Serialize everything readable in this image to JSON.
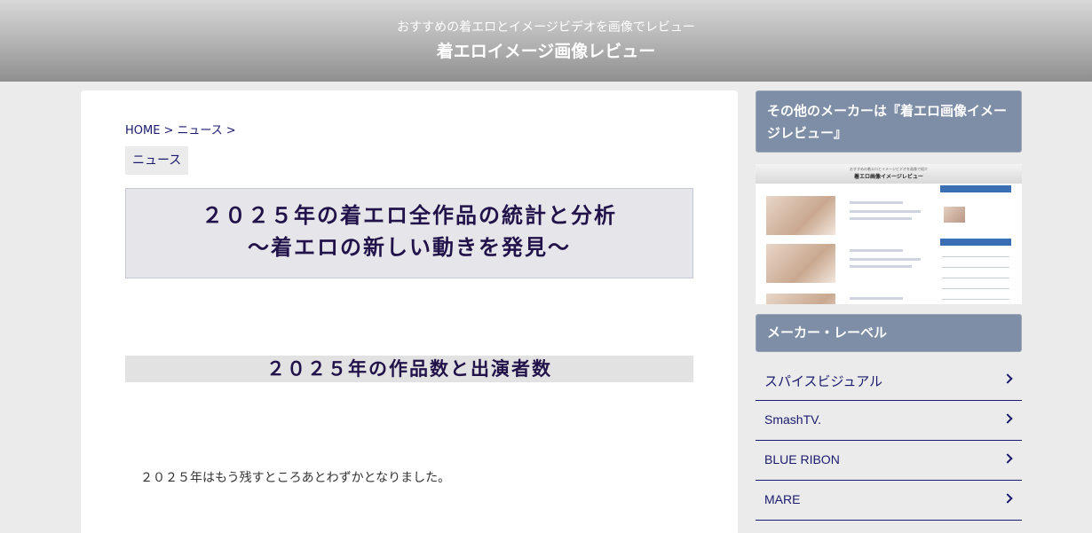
{
  "header": {
    "tagline": "おすすめの着エロとイメージビデオを画像でレビュー",
    "title": "着エロイメージ画像レビュー"
  },
  "breadcrumb": {
    "items": [
      "HOME",
      "ニュース"
    ],
    "separator": ">"
  },
  "category_tag": "ニュース",
  "article": {
    "title_line1": "２０２５年の着エロ全作品の統計と分析",
    "title_line2": "〜着エロの新しい動きを発見〜",
    "section_heading": "２０２５年の作品数と出演者数",
    "body": "２０２５年はもう残すところあとわずかとなりました。"
  },
  "sidebar": {
    "other_makers_heading": "その他のメーカーは『着エロ画像イメージレビュー』",
    "thumbnail": {
      "tagline": "おすすめの着エロとイメージビデオを画像で紹介",
      "title": "着エロ画像イメージレビュー"
    },
    "makers_heading": "メーカー・レーベル",
    "makers": [
      {
        "label": "スパイスビジュアル"
      },
      {
        "label": "SmashTV."
      },
      {
        "label": "BLUE RIBON"
      },
      {
        "label": "MARE"
      }
    ]
  },
  "colors": {
    "link": "#1a1a6e",
    "sidebar_head": "#7d8ea6",
    "title_text": "#22124a"
  }
}
